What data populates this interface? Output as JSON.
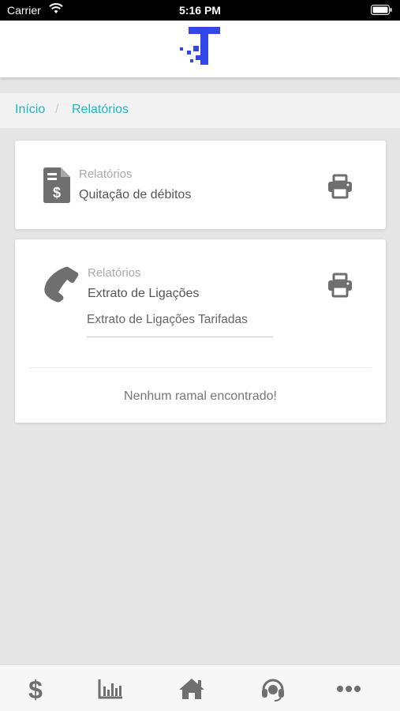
{
  "status_bar": {
    "carrier": "Carrier",
    "time": "5:16 PM"
  },
  "brand": {
    "accent_color": "#3347e8",
    "icon": "t-logo-icon"
  },
  "breadcrumb": {
    "items": [
      {
        "label": "Início"
      },
      {
        "label": "Relatórios"
      }
    ],
    "separator": "/",
    "link_color": "#1fb5c8"
  },
  "cards": [
    {
      "icon": "invoice-dollar-icon",
      "subtitle": "Relatórios",
      "title": "Quitação de débitos",
      "action_icon": "print-icon"
    },
    {
      "icon": "phone-icon",
      "subtitle": "Relatórios",
      "title": "Extrato de Ligações",
      "action_icon": "print-icon",
      "select_value": "Extrato de Ligações Tarifadas",
      "empty_message": "Nenhum ramal encontrado!"
    }
  ],
  "tab_bar": {
    "items": [
      {
        "icon": "dollar-icon"
      },
      {
        "icon": "bar-chart-icon"
      },
      {
        "icon": "home-icon"
      },
      {
        "icon": "headset-icon"
      },
      {
        "icon": "more-icon"
      }
    ]
  }
}
